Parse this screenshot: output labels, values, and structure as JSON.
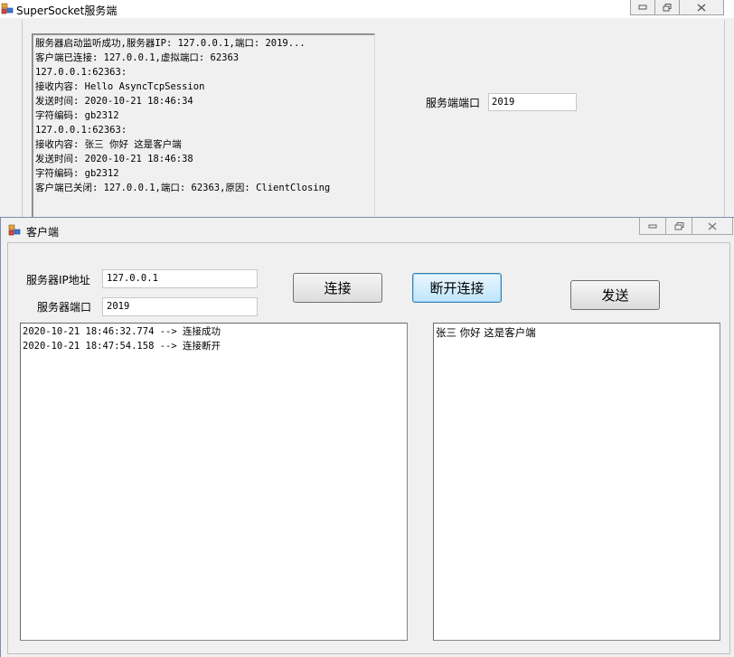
{
  "server": {
    "title": "SuperSocket服务端",
    "log_lines": [
      "服务器启动监听成功,服务器IP: 127.0.0.1,端口: 2019...",
      "客户端已连接: 127.0.0.1,虚拟端口: 62363",
      "127.0.0.1:62363:",
      "接收内容: Hello AsyncTcpSession",
      "发送时间: 2020-10-21 18:46:34",
      "字符编码: gb2312",
      "127.0.0.1:62363:",
      "接收内容: 张三 你好 这是客户端",
      "发送时间: 2020-10-21 18:46:38",
      "字符编码: gb2312",
      "客户端已关闭: 127.0.0.1,端口: 62363,原因: ClientClosing"
    ],
    "port_label": "服务端端口",
    "port_value": "2019",
    "icons": {
      "app": "app-icon",
      "minimize": "minimize-icon",
      "maximize": "maximize-icon",
      "close": "close-icon"
    }
  },
  "client": {
    "title": "客户端",
    "ip_label": "服务器IP地址",
    "ip_value": "127.0.0.1",
    "port_label": "服务器端口",
    "port_value": "2019",
    "connect_button": "连接",
    "disconnect_button": "断开连接",
    "send_button": "发送",
    "log_lines": [
      "2020-10-21 18:46:32.774 --> 连接成功",
      "2020-10-21 18:47:54.158 --> 连接断开"
    ],
    "message": "张三 你好 这是客户端",
    "icons": {
      "app": "app-icon",
      "minimize": "minimize-icon",
      "maximize": "maximize-icon",
      "close": "close-icon"
    }
  }
}
